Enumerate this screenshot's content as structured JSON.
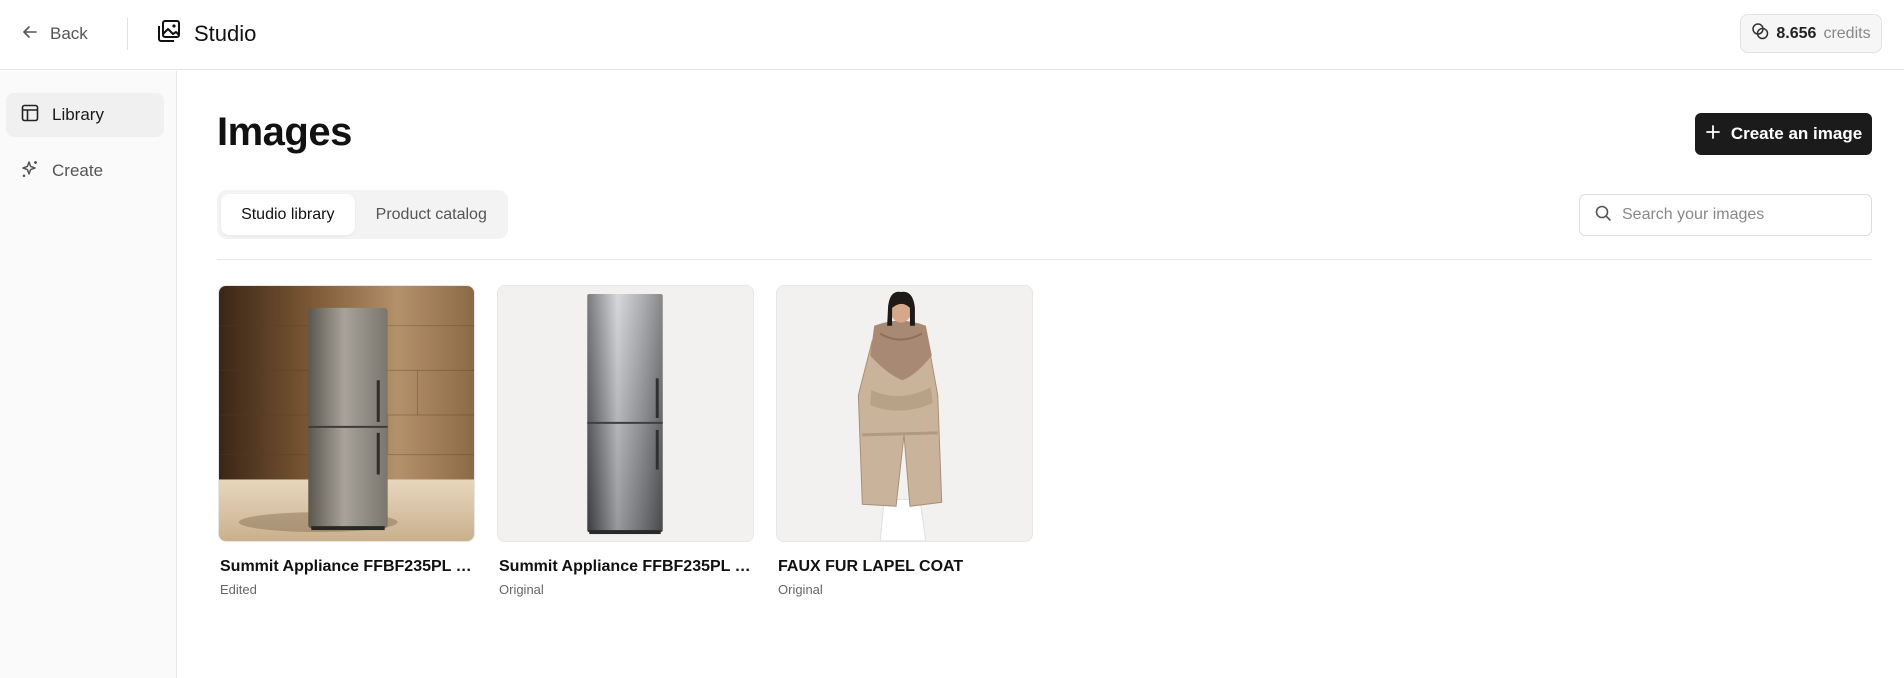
{
  "topbar": {
    "back_label": "Back",
    "app_title": "Studio",
    "credits_value": "8.656",
    "credits_unit": "credits"
  },
  "sidebar": {
    "items": [
      {
        "label": "Library",
        "icon": "library-icon",
        "active": true
      },
      {
        "label": "Create",
        "icon": "sparkle-icon",
        "active": false
      }
    ]
  },
  "main": {
    "title": "Images",
    "create_button": "Create an image",
    "tabs": [
      {
        "label": "Studio library",
        "active": true
      },
      {
        "label": "Product catalog",
        "active": false
      }
    ],
    "search": {
      "placeholder": "Search your images",
      "value": ""
    },
    "images": [
      {
        "title": "Summit Appliance FFBF235PL 2...",
        "status": "Edited",
        "thumb": "fridge-wood-background"
      },
      {
        "title": "Summit Appliance FFBF235PL 2...",
        "status": "Original",
        "thumb": "fridge-plain"
      },
      {
        "title": "FAUX FUR LAPEL COAT",
        "status": "Original",
        "thumb": "coat-model"
      }
    ]
  },
  "colors": {
    "primary_button": "#1b1b1b",
    "sidebar_bg": "#fafafa",
    "border": "#e6e6e6"
  }
}
